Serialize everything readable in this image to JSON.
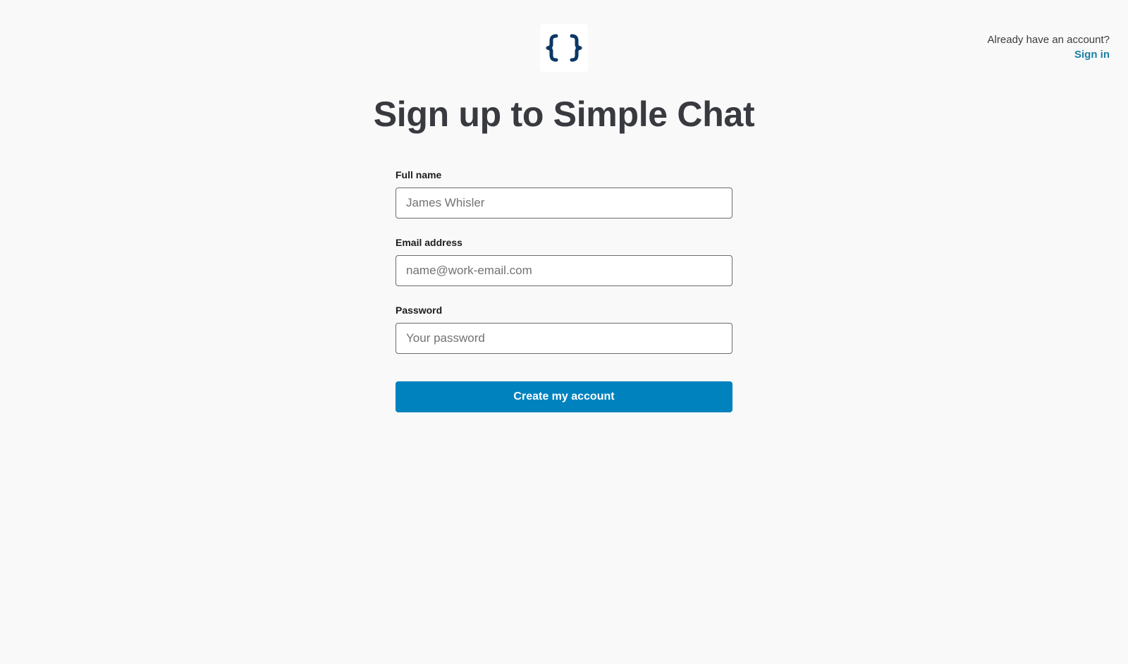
{
  "header": {
    "logo_icon": "curly-braces-icon",
    "signin_prompt": "Already have an account?",
    "signin_link": "Sign in"
  },
  "main": {
    "title": "Sign up to Simple Chat"
  },
  "form": {
    "full_name": {
      "label": "Full name",
      "placeholder": "James Whisler",
      "value": ""
    },
    "email": {
      "label": "Email address",
      "placeholder": "name@work-email.com",
      "value": ""
    },
    "password": {
      "label": "Password",
      "placeholder": "Your password",
      "value": ""
    },
    "submit_label": "Create my account"
  },
  "colors": {
    "background": "#f9f9f9",
    "title": "#383a40",
    "link": "#1a7fa6",
    "button": "#0082bf",
    "logo": "#0b3765"
  }
}
